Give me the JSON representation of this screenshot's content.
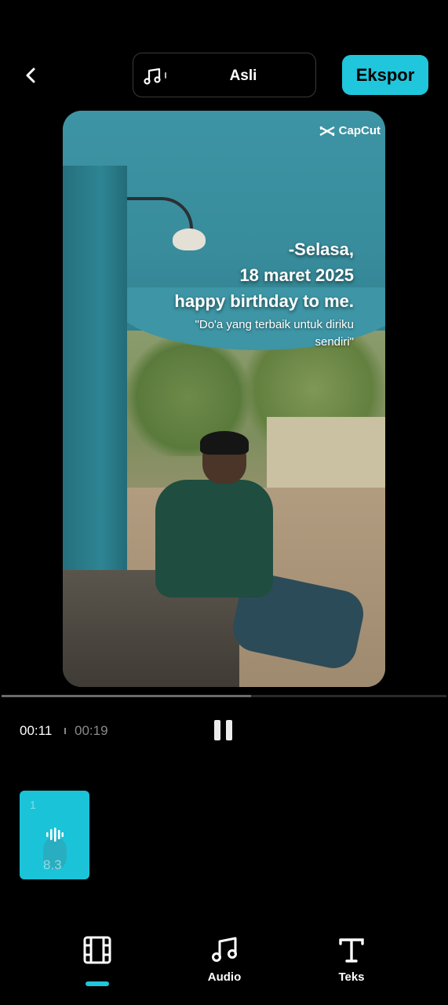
{
  "header": {
    "back_icon": "chevron-left-icon",
    "music_icon": "music-note-icon",
    "music_label": "Asli",
    "export_label": "Ekspor",
    "accent_color": "#1fc6dc"
  },
  "preview": {
    "watermark": "CapCut",
    "overlay_line1": "-Selasa,",
    "overlay_line2": "18 maret 2025",
    "overlay_line3": "happy birthday to me.",
    "quote": "\"Do'a yang terbaik untuk diriku sendiri\""
  },
  "playback": {
    "current_time": "00:11",
    "total_time": "00:19",
    "progress_fraction": 0.56,
    "pause_icon": "pause-icon"
  },
  "timeline": {
    "clips": [
      {
        "index": "1",
        "duration": "8.3",
        "icon": "audio-wave-icon"
      }
    ]
  },
  "bottom_nav": {
    "items": [
      {
        "label": "",
        "icon": "film-strip-icon",
        "active": true
      },
      {
        "label": "Audio",
        "icon": "music-note-icon",
        "active": false
      },
      {
        "label": "Teks",
        "icon": "text-icon",
        "active": false
      }
    ]
  }
}
